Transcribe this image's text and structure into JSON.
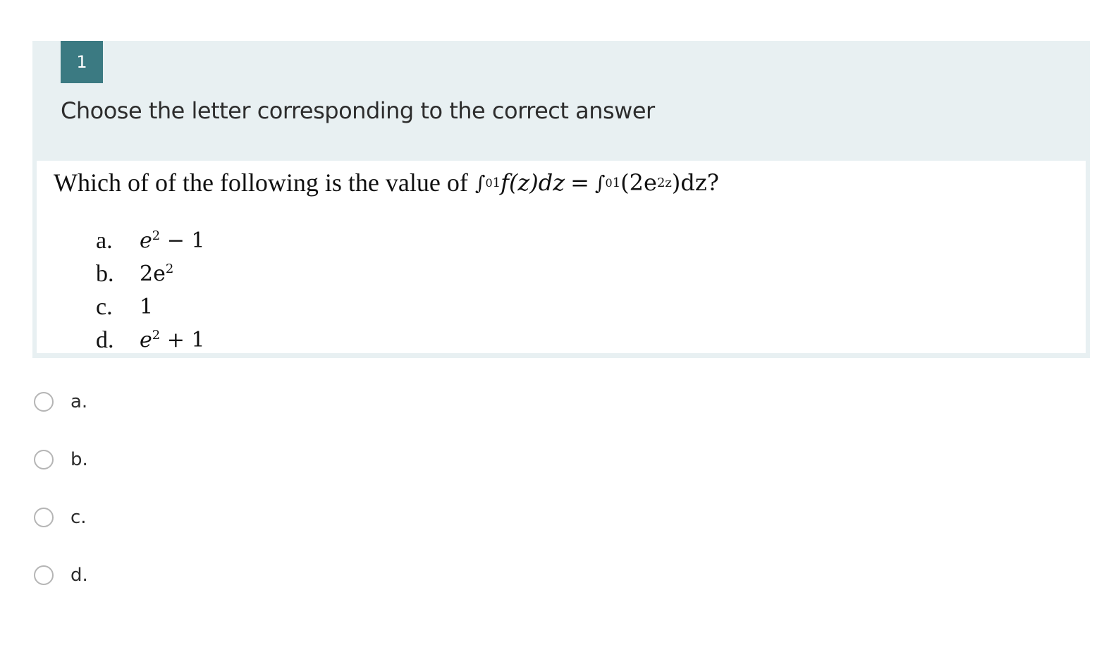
{
  "question": {
    "number": "1",
    "instruction": "Choose the letter corresponding to the correct answer",
    "stem_text": "Which of of the following is the value of",
    "integral": {
      "lower": "0",
      "upper": "1",
      "left_integrand": "f(z)dz",
      "equals": "=",
      "right_integrand_prefix": "(2e",
      "right_exponent": "2z",
      "right_integrand_suffix": ")dz?"
    },
    "choices": [
      {
        "letter": "a.",
        "base": "e",
        "exp": "2",
        "rest": " − 1"
      },
      {
        "letter": "b.",
        "base": "2e",
        "exp": "2",
        "rest": ""
      },
      {
        "letter": "c.",
        "base": "1",
        "exp": "",
        "rest": ""
      },
      {
        "letter": "d.",
        "base": "e",
        "exp": "2",
        "rest": " + 1"
      }
    ]
  },
  "answers": {
    "options": [
      {
        "label": "a.",
        "selected": false
      },
      {
        "label": "b.",
        "selected": false
      },
      {
        "label": "c.",
        "selected": false
      },
      {
        "label": "d.",
        "selected": false
      }
    ]
  },
  "colors": {
    "badge": "#3b7a82",
    "card_background": "#e8f0f2",
    "radio_border": "#b5b5b5"
  }
}
